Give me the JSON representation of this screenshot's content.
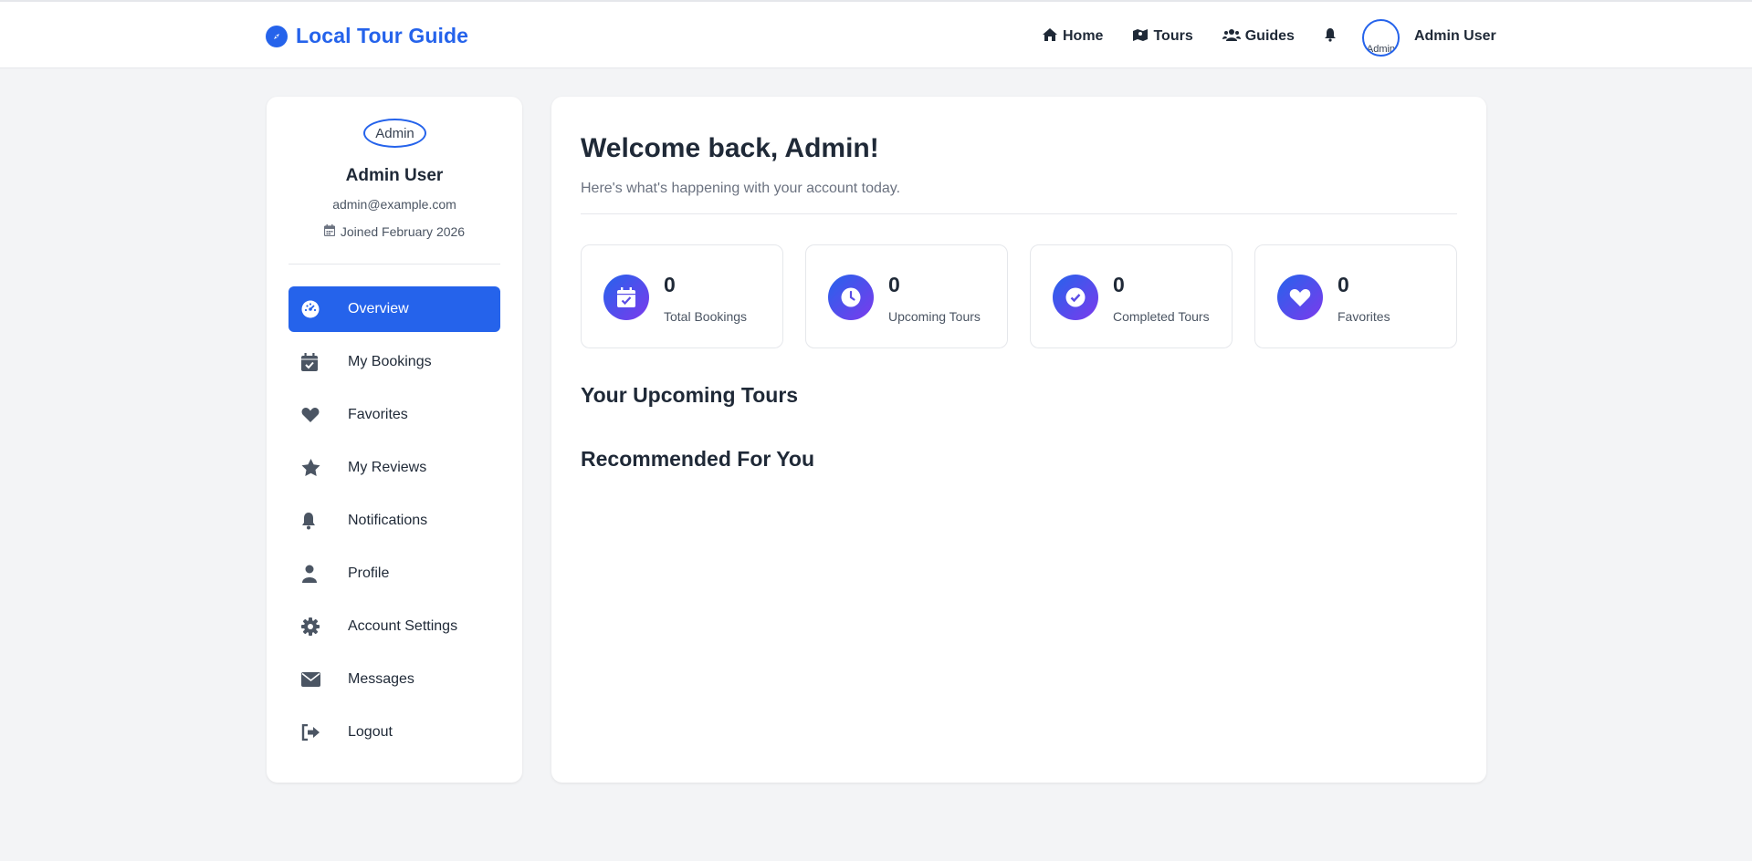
{
  "brand": {
    "name": "Local Tour Guide",
    "icon": "compass-icon"
  },
  "nav": {
    "items": [
      {
        "label": "Home",
        "icon": "home-icon"
      },
      {
        "label": "Tours",
        "icon": "map-icon"
      },
      {
        "label": "Guides",
        "icon": "users-icon"
      }
    ],
    "notifications_icon": "bell-icon",
    "avatar_alt": "Admin",
    "user_name": "Admin User"
  },
  "profile": {
    "avatar_alt": "Admin",
    "name": "Admin User",
    "email": "admin@example.com",
    "joined": "Joined February 2026"
  },
  "sidebar": {
    "items": [
      {
        "label": "Overview",
        "icon": "dashboard-icon",
        "active": true
      },
      {
        "label": "My Bookings",
        "icon": "calendar-check-icon"
      },
      {
        "label": "Favorites",
        "icon": "heart-icon"
      },
      {
        "label": "My Reviews",
        "icon": "star-icon"
      },
      {
        "label": "Notifications",
        "icon": "bell-icon"
      },
      {
        "label": "Profile",
        "icon": "user-icon"
      },
      {
        "label": "Account Settings",
        "icon": "gear-icon"
      },
      {
        "label": "Messages",
        "icon": "envelope-icon"
      },
      {
        "label": "Logout",
        "icon": "logout-icon"
      }
    ]
  },
  "main": {
    "welcome": "Welcome back, Admin!",
    "subtitle": "Here's what's happening with your account today.",
    "stats": [
      {
        "value": "0",
        "label": "Total Bookings",
        "icon": "calendar-check-icon"
      },
      {
        "value": "0",
        "label": "Upcoming Tours",
        "icon": "clock-icon"
      },
      {
        "value": "0",
        "label": "Completed Tours",
        "icon": "check-circle-icon"
      },
      {
        "value": "0",
        "label": "Favorites",
        "icon": "heart-icon"
      }
    ],
    "upcoming_title": "Your Upcoming Tours",
    "recommended_title": "Recommended For You"
  },
  "colors": {
    "primary": "#2563eb",
    "gradient_end": "#7c3aed",
    "background": "#f3f4f6"
  }
}
